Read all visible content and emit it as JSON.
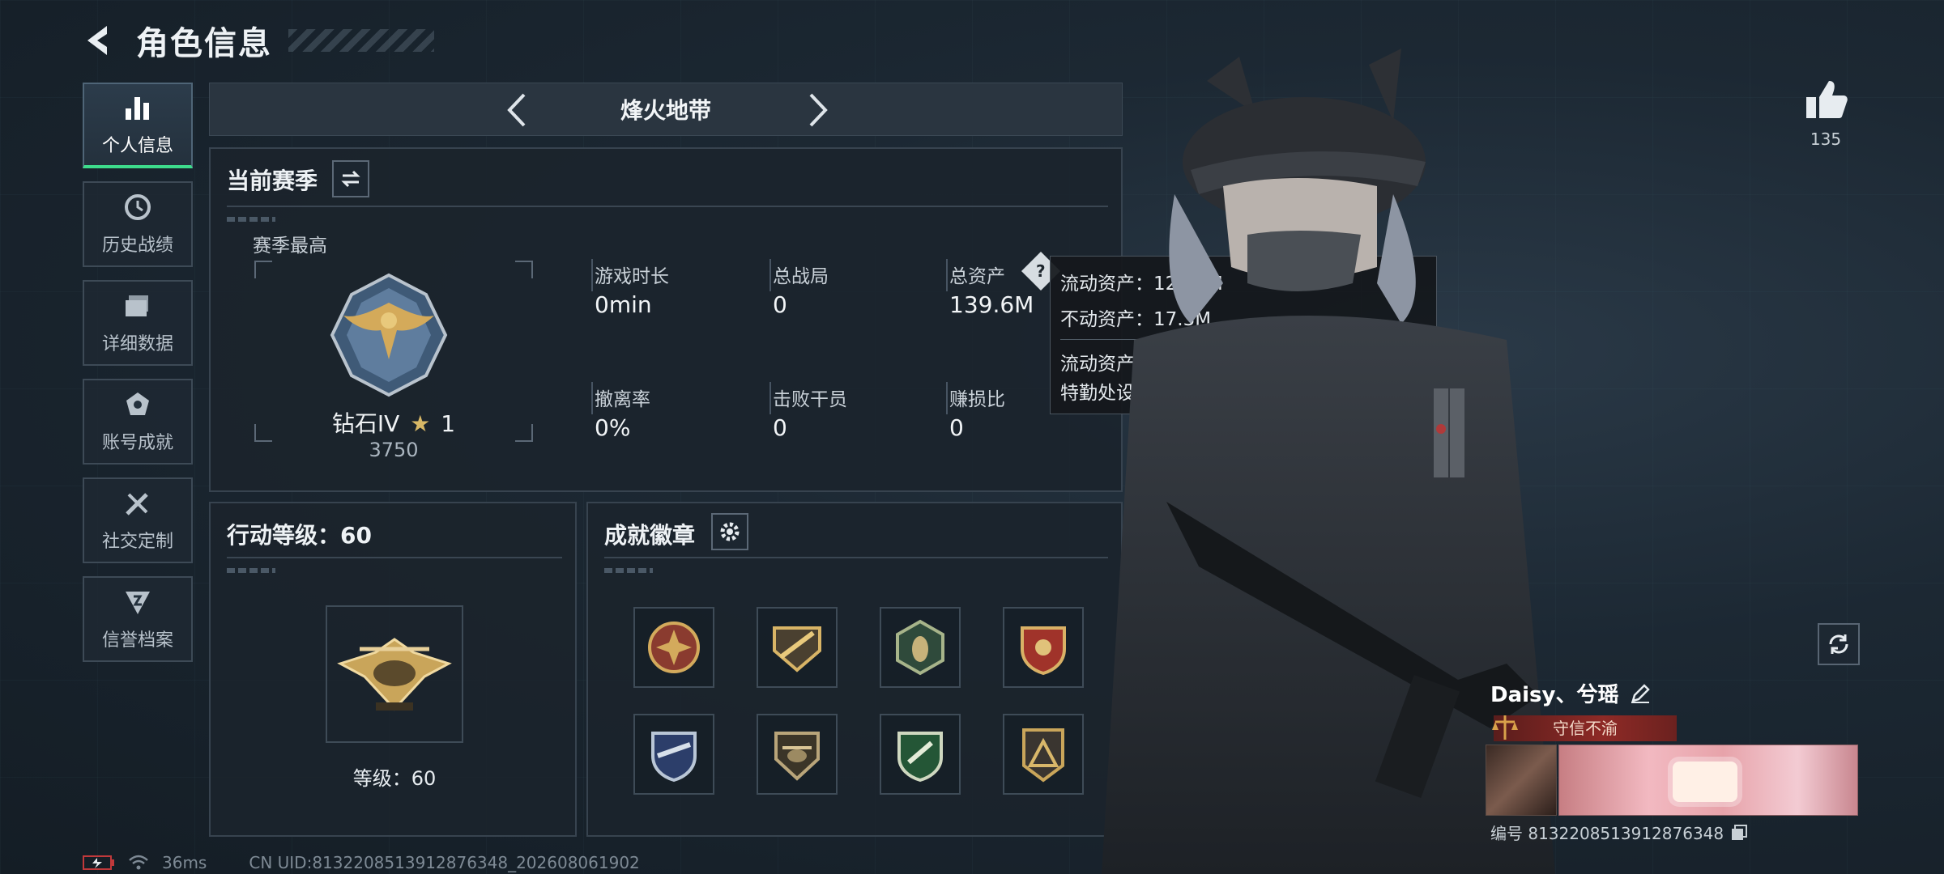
{
  "header": {
    "title": "角色信息"
  },
  "sidebar": {
    "items": [
      {
        "label": "个人信息",
        "icon": "bar-chart-icon",
        "active": true
      },
      {
        "label": "历史战绩",
        "icon": "history-clock-icon"
      },
      {
        "label": "详细数据",
        "icon": "folder-icon"
      },
      {
        "label": "账号成就",
        "icon": "achievement-icon"
      },
      {
        "label": "社交定制",
        "icon": "tools-icon"
      },
      {
        "label": "信誉档案",
        "icon": "credit-icon"
      }
    ]
  },
  "mode": {
    "title": "烽火地带"
  },
  "season": {
    "title": "当前赛季",
    "best_label": "赛季最高",
    "rank_name": "钻石IV",
    "rank_stars": "1",
    "rank_score": "3750",
    "stats": [
      {
        "label": "游戏时长",
        "value": "0min"
      },
      {
        "label": "总战局",
        "value": "0"
      },
      {
        "label": "总资产",
        "value": "139.6M"
      },
      {
        "label": "撤离率",
        "value": "0%"
      },
      {
        "label": "击败干员",
        "value": "0"
      },
      {
        "label": "赚损比",
        "value": "0"
      }
    ]
  },
  "tooltip": {
    "liquid": "流动资产：122.4M",
    "fixed": "不动资产：17.3M",
    "desc": "流动资产为仓库资产和哈夫币，不动资产为特勤处设施和收藏室设施"
  },
  "action_level": {
    "title": "行动等级：60",
    "level_text": "等级：60"
  },
  "badges": {
    "title": "成就徽章",
    "items": [
      "medal-cross-icon",
      "medal-jet-icon",
      "medal-wasp-icon",
      "medal-shield-icon",
      "medal-wings-icon",
      "medal-heli-icon",
      "medal-drone-icon",
      "medal-triangle-icon"
    ]
  },
  "likes": {
    "count": "135"
  },
  "player": {
    "name": "Daisy、兮瑶",
    "title": "守信不渝",
    "id": "编号 8132208513912876348"
  },
  "status": {
    "ping": "36ms",
    "uid": "CN UID:8132208513912876348_202608061902"
  },
  "colors": {
    "accent": "#3ddc8c",
    "gold": "#c9a55a",
    "banner": "#8e2a26"
  }
}
